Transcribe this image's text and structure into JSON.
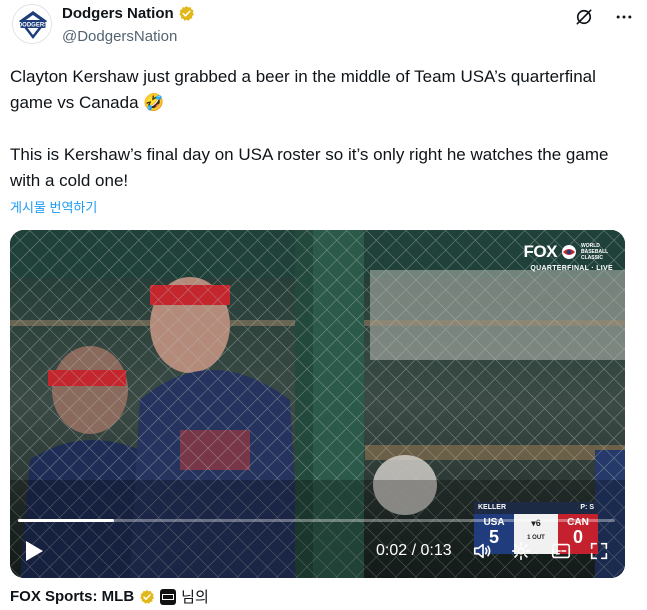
{
  "author": {
    "display_name": "Dodgers Nation",
    "handle": "@DodgersNation",
    "verified": true,
    "avatar_icon": "dodgers-nation-logo"
  },
  "tweet": {
    "text": "Clayton Kershaw just grabbed a beer in the middle of Team USA’s quarterfinal game vs Canada 🤣\n\nThis is Kershaw’s final day on USA roster so it’s only right he watches the game with a cold one!",
    "translate_label": "게시물 번역하기"
  },
  "media": {
    "broadcaster": "FOX",
    "event_lines": [
      "WORLD",
      "BASEBALL",
      "CLASSIC"
    ],
    "event_stage": "QUARTERFINAL · LIVE",
    "scorebug": {
      "batter": "KELLER",
      "pitch_info": "P: S",
      "home_team": "USA",
      "home_score": "5",
      "inning": "▾6",
      "outs": "1 OUT",
      "away_team": "CAN",
      "away_score": "0"
    },
    "time_display": "0:02 / 0:13",
    "progress_fraction": 0.16
  },
  "source": {
    "name": "FOX Sports: MLB",
    "suffix": "님의"
  },
  "colors": {
    "link": "#1d9bf0",
    "verified_gold": "#e2b719",
    "muted": "#536471"
  },
  "icons": [
    "grok-icon",
    "more-icon",
    "play-icon",
    "volume-icon",
    "settings-icon",
    "captions-icon",
    "fullscreen-icon"
  ]
}
